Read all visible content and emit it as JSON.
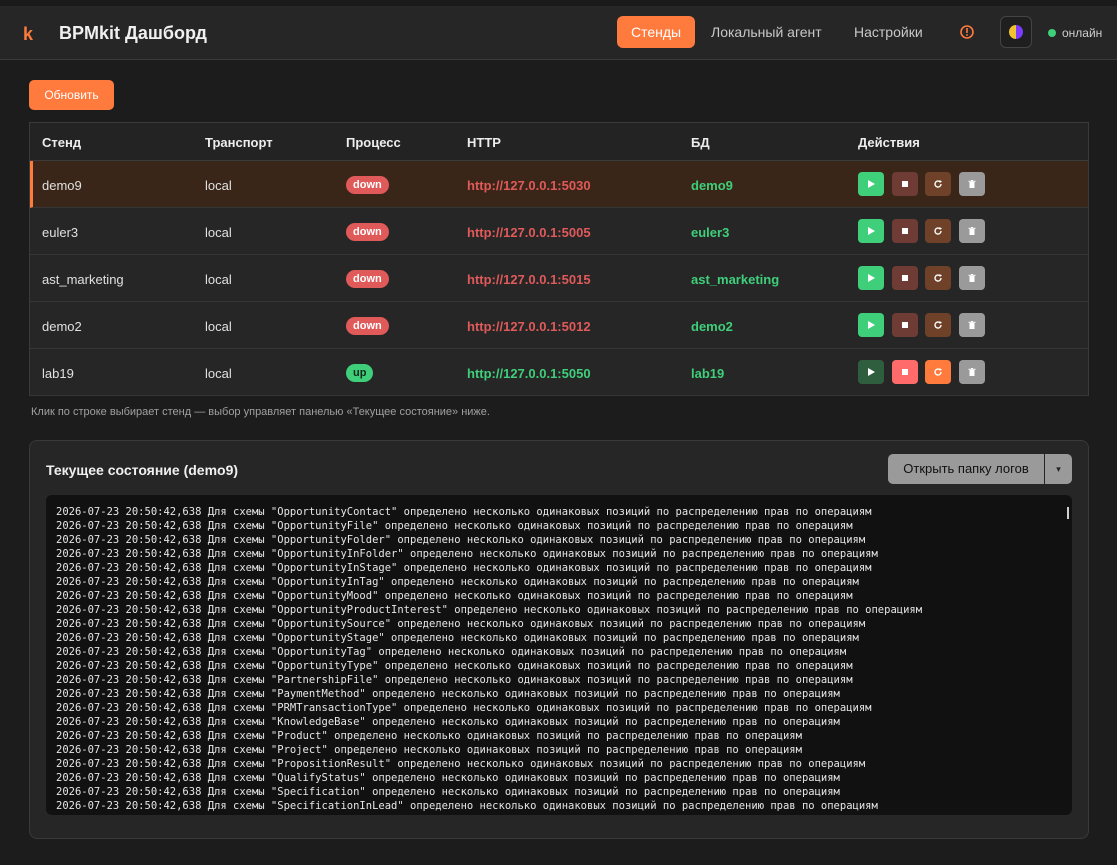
{
  "app": {
    "logo": "k",
    "title": "BPMkit Дашборд"
  },
  "nav": {
    "stands": "Стенды",
    "agent": "Локальный агент",
    "settings": "Настройки"
  },
  "status": {
    "label": "онлайн",
    "color": "#3fcf7a"
  },
  "refresh_label": "Обновить",
  "table": {
    "headers": {
      "stand": "Стенд",
      "transport": "Транспорт",
      "process": "Процесс",
      "http": "HTTP",
      "db": "БД",
      "actions": "Действия"
    },
    "rows": [
      {
        "stand": "demo9",
        "transport": "local",
        "process": "down",
        "http": "http://127.0.0.1:5030",
        "db": "demo9"
      },
      {
        "stand": "euler3",
        "transport": "local",
        "process": "down",
        "http": "http://127.0.0.1:5005",
        "db": "euler3"
      },
      {
        "stand": "ast_marketing",
        "transport": "local",
        "process": "down",
        "http": "http://127.0.0.1:5015",
        "db": "ast_marketing"
      },
      {
        "stand": "demo2",
        "transport": "local",
        "process": "down",
        "http": "http://127.0.0.1:5012",
        "db": "demo2"
      },
      {
        "stand": "lab19",
        "transport": "local",
        "process": "up",
        "http": "http://127.0.0.1:5050",
        "db": "lab19"
      }
    ]
  },
  "hint": "Клик по строке выбирает стенд — выбор управляет панелью «Текущее состояние» ниже.",
  "panel": {
    "title": "Текущее состояние (demo9)",
    "open_logs": "Открыть папку логов",
    "caret": "▾",
    "logs": [
      "2026-07-23 20:50:42,638 Для схемы \"OpportunityContact\" определено несколько одинаковых позиций по распределению прав по операциям",
      "2026-07-23 20:50:42,638 Для схемы \"OpportunityFile\" определено несколько одинаковых позиций по распределению прав по операциям",
      "2026-07-23 20:50:42,638 Для схемы \"OpportunityFolder\" определено несколько одинаковых позиций по распределению прав по операциям",
      "2026-07-23 20:50:42,638 Для схемы \"OpportunityInFolder\" определено несколько одинаковых позиций по распределению прав по операциям",
      "2026-07-23 20:50:42,638 Для схемы \"OpportunityInStage\" определено несколько одинаковых позиций по распределению прав по операциям",
      "2026-07-23 20:50:42,638 Для схемы \"OpportunityInTag\" определено несколько одинаковых позиций по распределению прав по операциям",
      "2026-07-23 20:50:42,638 Для схемы \"OpportunityMood\" определено несколько одинаковых позиций по распределению прав по операциям",
      "2026-07-23 20:50:42,638 Для схемы \"OpportunityProductInterest\" определено несколько одинаковых позиций по распределению прав по операциям",
      "2026-07-23 20:50:42,638 Для схемы \"OpportunitySource\" определено несколько одинаковых позиций по распределению прав по операциям",
      "2026-07-23 20:50:42,638 Для схемы \"OpportunityStage\" определено несколько одинаковых позиций по распределению прав по операциям",
      "2026-07-23 20:50:42,638 Для схемы \"OpportunityTag\" определено несколько одинаковых позиций по распределению прав по операциям",
      "2026-07-23 20:50:42,638 Для схемы \"OpportunityType\" определено несколько одинаковых позиций по распределению прав по операциям",
      "2026-07-23 20:50:42,638 Для схемы \"PartnershipFile\" определено несколько одинаковых позиций по распределению прав по операциям",
      "2026-07-23 20:50:42,638 Для схемы \"PaymentMethod\" определено несколько одинаковых позиций по распределению прав по операциям",
      "2026-07-23 20:50:42,638 Для схемы \"PRMTransactionType\" определено несколько одинаковых позиций по распределению прав по операциям",
      "2026-07-23 20:50:42,638 Для схемы \"KnowledgeBase\" определено несколько одинаковых позиций по распределению прав по операциям",
      "2026-07-23 20:50:42,638 Для схемы \"Product\" определено несколько одинаковых позиций по распределению прав по операциям",
      "2026-07-23 20:50:42,638 Для схемы \"Project\" определено несколько одинаковых позиций по распределению прав по операциям",
      "2026-07-23 20:50:42,638 Для схемы \"PropositionResult\" определено несколько одинаковых позиций по распределению прав по операциям",
      "2026-07-23 20:50:42,638 Для схемы \"QualifyStatus\" определено несколько одинаковых позиций по распределению прав по операциям",
      "2026-07-23 20:50:42,638 Для схемы \"Specification\" определено несколько одинаковых позиций по распределению прав по операциям",
      "2026-07-23 20:50:42,638 Для схемы \"SpecificationInLead\" определено несколько одинаковых позиций по распределению прав по операциям"
    ]
  },
  "colors": {
    "accent": "#ff7a3d",
    "up": "#3fcf7a",
    "down": "#e05a5a"
  }
}
